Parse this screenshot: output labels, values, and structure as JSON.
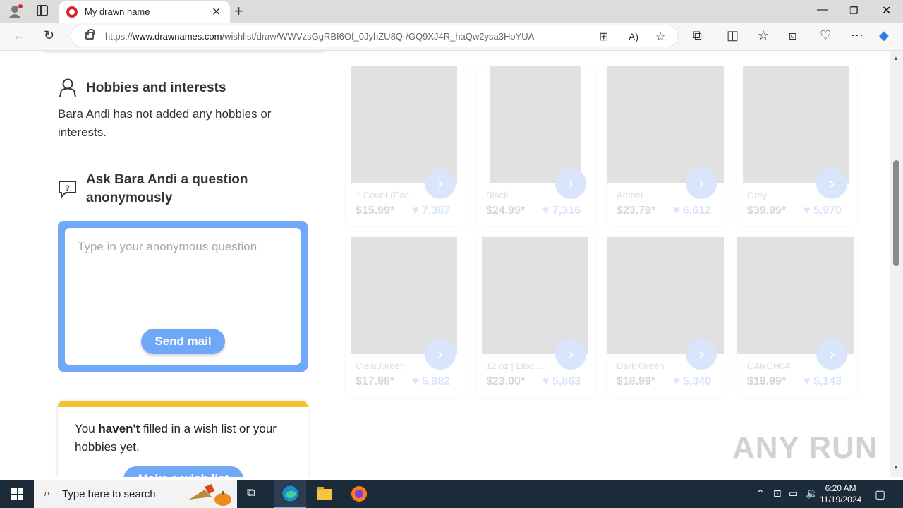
{
  "browser": {
    "tab_title": "My drawn name",
    "tab_close": "✕",
    "new_tab": "+",
    "url_prefix": "https://",
    "url_domain": "www.drawnames.com",
    "url_path": "/wishlist/draw/WWVzsGgRBI6Of_0JyhZU8Q-/GQ9XJ4R_haQw2ysa3HoYUA-"
  },
  "sections": {
    "hobbies_title": "Hobbies and interests",
    "hobbies_text": "Bara Andi has not added any hobbies or interests.",
    "question_title": "Ask Bara Andi a question anonymously",
    "question_placeholder": "Type in your anonymous question",
    "send_label": "Send mail",
    "wish_text_pre": "You ",
    "wish_text_bold": "haven't",
    "wish_text_post": " filled in a wish list or your hobbies yet.",
    "make_label": "Make a wish list"
  },
  "products": [
    {
      "name": "1 Count (Pac...",
      "price": "$15.99*",
      "likes": "7,387"
    },
    {
      "name": "Black",
      "price": "$24.99*",
      "likes": "7,316"
    },
    {
      "name": "Amber",
      "price": "$23.79*",
      "likes": "6,612"
    },
    {
      "name": "Grey",
      "price": "$39.99*",
      "likes": "5,970"
    },
    {
      "name": "Clear,Green",
      "price": "$17.98*",
      "likes": "5,882"
    },
    {
      "name": "12 oz | Lilac ...",
      "price": "$23.00*",
      "likes": "5,863"
    },
    {
      "name": "Dark Green",
      "price": "$18.99*",
      "likes": "5,340"
    },
    {
      "name": "CARCH04",
      "price": "$19.99*",
      "likes": "5,143"
    }
  ],
  "watermark": "ANY RUN",
  "taskbar": {
    "search_placeholder": "Type here to search",
    "time": "6:20 AM",
    "date": "11/19/2024"
  }
}
